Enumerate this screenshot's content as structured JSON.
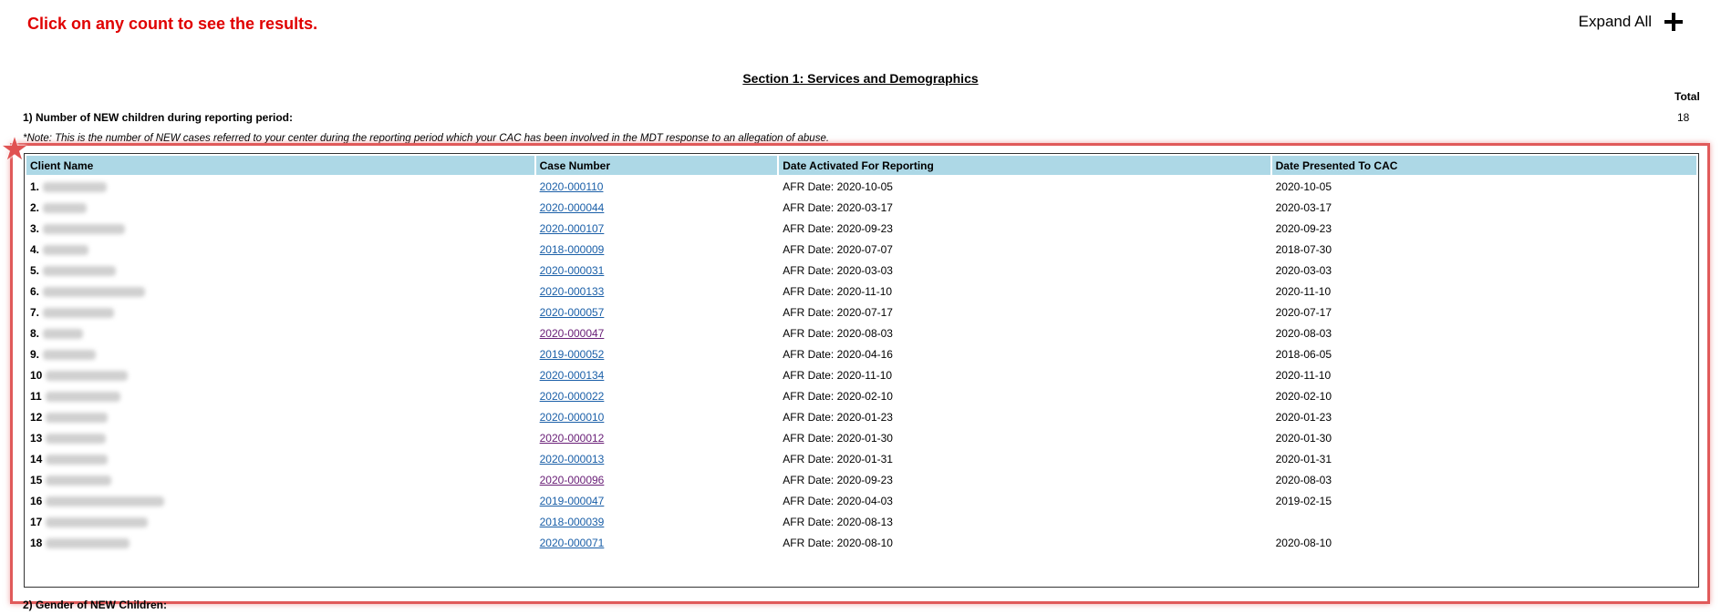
{
  "instruction": "Click on any count to see the results.",
  "expand_all": {
    "label": "Expand All",
    "icon": "plus-icon"
  },
  "section_title": "Section 1: Services and Demographics",
  "total_header": "Total",
  "question1": {
    "label": "1) Number of NEW children during reporting period:",
    "value": "18",
    "note": "*Note: This is the number of NEW cases referred to your center during the reporting period which your CAC has been involved in the MDT response to an allegation of abuse."
  },
  "table": {
    "headers": [
      "Client Name",
      "Case Number",
      "Date Activated For Reporting",
      "Date Presented To CAC"
    ],
    "rows": [
      {
        "num": "1.",
        "case": "2020-000110",
        "afr": "AFR Date: 2020-10-05",
        "presented": "2020-10-05",
        "visited": false
      },
      {
        "num": "2.",
        "case": "2020-000044",
        "afr": "AFR Date: 2020-03-17",
        "presented": "2020-03-17",
        "visited": false
      },
      {
        "num": "3.",
        "case": "2020-000107",
        "afr": "AFR Date: 2020-09-23",
        "presented": "2020-09-23",
        "visited": false
      },
      {
        "num": "4.",
        "case": "2018-000009",
        "afr": "AFR Date: 2020-07-07",
        "presented": "2018-07-30",
        "visited": false
      },
      {
        "num": "5.",
        "case": "2020-000031",
        "afr": "AFR Date: 2020-03-03",
        "presented": "2020-03-03",
        "visited": false
      },
      {
        "num": "6.",
        "case": "2020-000133",
        "afr": "AFR Date: 2020-11-10",
        "presented": "2020-11-10",
        "visited": false
      },
      {
        "num": "7.",
        "case": "2020-000057",
        "afr": "AFR Date: 2020-07-17",
        "presented": "2020-07-17",
        "visited": false
      },
      {
        "num": "8.",
        "case": "2020-000047",
        "afr": "AFR Date: 2020-08-03",
        "presented": "2020-08-03",
        "visited": true
      },
      {
        "num": "9.",
        "case": "2019-000052",
        "afr": "AFR Date: 2020-04-16",
        "presented": "2018-06-05",
        "visited": false
      },
      {
        "num": "10",
        "case": "2020-000134",
        "afr": "AFR Date: 2020-11-10",
        "presented": "2020-11-10",
        "visited": false
      },
      {
        "num": "11",
        "case": "2020-000022",
        "afr": "AFR Date: 2020-02-10",
        "presented": "2020-02-10",
        "visited": false
      },
      {
        "num": "12",
        "case": "2020-000010",
        "afr": "AFR Date: 2020-01-23",
        "presented": "2020-01-23",
        "visited": false
      },
      {
        "num": "13",
        "case": "2020-000012",
        "afr": "AFR Date: 2020-01-30",
        "presented": "2020-01-30",
        "visited": true
      },
      {
        "num": "14",
        "case": "2020-000013",
        "afr": "AFR Date: 2020-01-31",
        "presented": "2020-01-31",
        "visited": false
      },
      {
        "num": "15",
        "case": "2020-000096",
        "afr": "AFR Date: 2020-09-23",
        "presented": "2020-08-03",
        "visited": true
      },
      {
        "num": "16",
        "case": "2019-000047",
        "afr": "AFR Date: 2020-04-03",
        "presented": "2019-02-15",
        "visited": false
      },
      {
        "num": "17",
        "case": "2018-000039",
        "afr": "AFR Date: 2020-08-13",
        "presented": "",
        "visited": false
      },
      {
        "num": "18",
        "case": "2020-000071",
        "afr": "AFR Date: 2020-08-10",
        "presented": "2020-08-10",
        "visited": false
      }
    ]
  },
  "question2": {
    "label": "2) Gender of NEW Children:"
  },
  "colors": {
    "instruction": "#e00000",
    "header_bg": "#add8e6",
    "link": "#1a5fa8",
    "visited_link": "#6a2078",
    "highlight": "#e05a5a"
  }
}
